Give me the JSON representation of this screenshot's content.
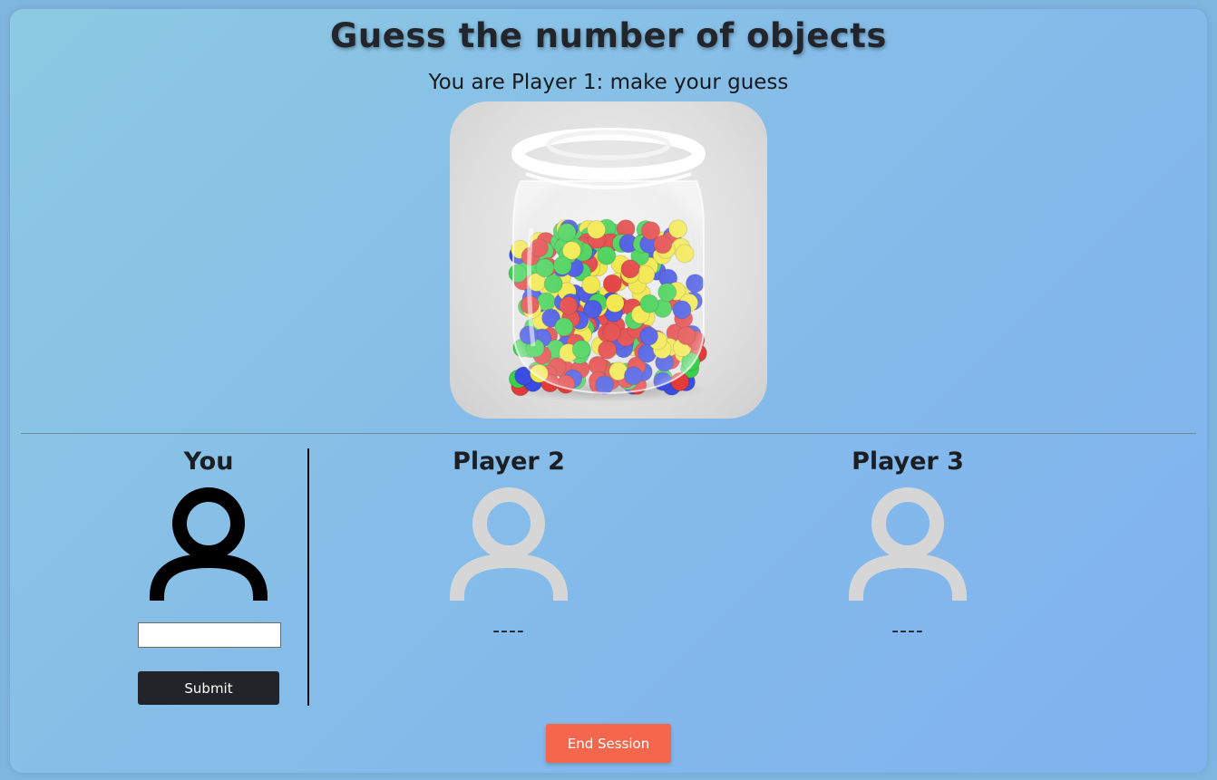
{
  "header": {
    "title": "Guess the number of objects",
    "subtitle": "You are Player 1: make your guess"
  },
  "image": {
    "description_icon": "jar-of-balls-image"
  },
  "players": [
    {
      "name": "You",
      "status": "active",
      "icon": "user-icon",
      "color": "#000000"
    },
    {
      "name": "Player 2",
      "guess": "----",
      "icon": "user-icon",
      "color": "#d6d6d6"
    },
    {
      "name": "Player 3",
      "guess": "----",
      "icon": "user-icon",
      "color": "#d6d6d6"
    }
  ],
  "form": {
    "guess_value": "",
    "submit_label": "Submit"
  },
  "footer": {
    "end_session_label": "End Session"
  },
  "colors": {
    "submit_bg": "#212529",
    "end_session_bg": "#f5674d",
    "inactive_avatar": "#d6d6d6"
  }
}
